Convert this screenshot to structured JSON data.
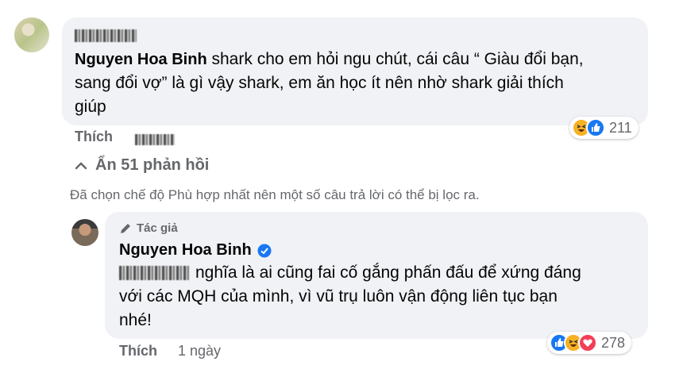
{
  "comment": {
    "author": "Nguyen Hoa Binh",
    "text_rest": " shark cho em hỏi ngu chút, cái câu “ Giàu đổi bạn,",
    "line2": "sang đổi vợ” là gì vậy shark, em ăn học ít nên nhờ shark giải thích",
    "line3": "giúp",
    "like_label": "Thích",
    "reaction_count": "211"
  },
  "replies_toggle": "Ẩn 51 phản hồi",
  "filter_notice": "Đã chọn chế độ Phù hợp nhất nên một số câu trả lời có thể bị lọc ra.",
  "reply": {
    "author_badge": "Tác giả",
    "author": "Nguyen Hoa Binh",
    "line1": "nghĩa là ai cũng fai cố gắng phấn đấu để xứng đáng",
    "line2": "với các MQH của mình, vì vũ trụ luôn vận động liên tục bạn",
    "line3": "nhé!",
    "like_label": "Thích",
    "time": "1 ngày",
    "reaction_count": "278"
  },
  "colors": {
    "bubble": "#f0f2f5",
    "meta": "#65676b",
    "like_blue": "#1877f2",
    "haha_yellow": "#f7b125",
    "love_red": "#f33e58"
  }
}
